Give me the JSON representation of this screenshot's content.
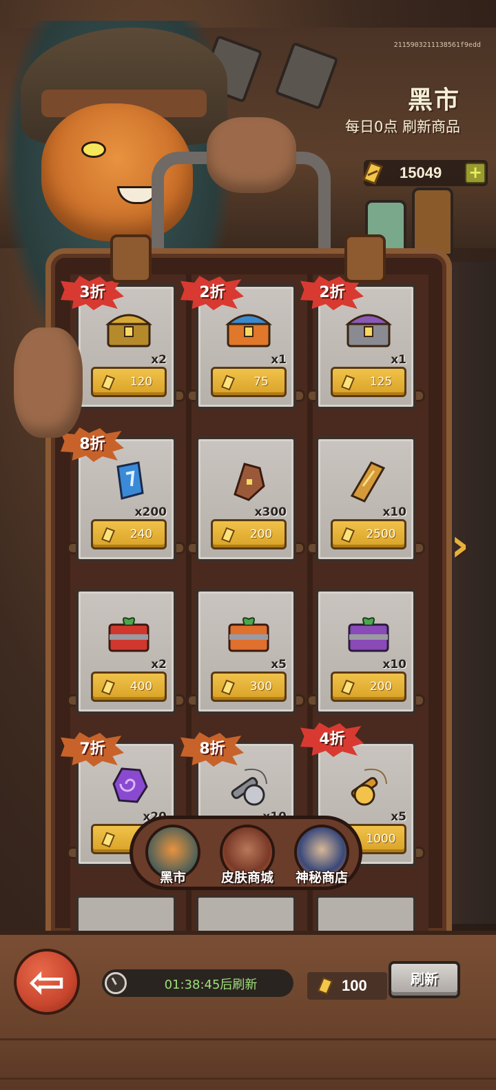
{
  "header": {
    "title": "黑市",
    "subtitle": "每日0点 刷新商品",
    "user_id": "2115903211138561f9edd",
    "currency_amount": "15049",
    "add_currency_label": "+"
  },
  "items": [
    {
      "name": "gold-chest",
      "discount": "3折",
      "discount_color": "red",
      "qty": "x2",
      "price": "120"
    },
    {
      "name": "blue-chest",
      "discount": "2折",
      "discount_color": "red",
      "qty": "x1",
      "price": "75"
    },
    {
      "name": "purple-chest",
      "discount": "2折",
      "discount_color": "red",
      "qty": "x1",
      "price": "125"
    },
    {
      "name": "blue-rune-stone",
      "discount": "8折",
      "discount_color": "orange",
      "qty": "x200",
      "price": "240"
    },
    {
      "name": "brown-coffin-stone",
      "discount": "",
      "discount_color": "",
      "qty": "x300",
      "price": "200"
    },
    {
      "name": "golden-coffin",
      "discount": "",
      "discount_color": "",
      "qty": "x10",
      "price": "2500"
    },
    {
      "name": "red-gift-box",
      "discount": "",
      "discount_color": "",
      "qty": "x2",
      "price": "400"
    },
    {
      "name": "orange-gift-box",
      "discount": "",
      "discount_color": "",
      "qty": "x5",
      "price": "300"
    },
    {
      "name": "purple-gift-box",
      "discount": "",
      "discount_color": "",
      "qty": "x10",
      "price": "200"
    },
    {
      "name": "purple-spiral-stone",
      "discount": "7折",
      "discount_color": "orange",
      "qty": "x20",
      "price": ""
    },
    {
      "name": "silver-fishing-reel",
      "discount": "8折",
      "discount_color": "orange",
      "qty": "x10",
      "price": ""
    },
    {
      "name": "gold-fishing-reel",
      "discount": "4折",
      "discount_color": "red",
      "qty": "x5",
      "price": "1000"
    }
  ],
  "tabs": [
    {
      "label": "黑市",
      "active": true
    },
    {
      "label": "皮肤商城",
      "active": false
    },
    {
      "label": "神秘商店",
      "active": false
    }
  ],
  "bottom": {
    "timer_text": "01:38:45后刷新",
    "refresh_cost": "100",
    "refresh_label": "刷新"
  },
  "colors": {
    "discount_red": "#d83a32",
    "discount_orange": "#c7632a",
    "price_gold": "#f0c24a",
    "timer_green": "#9fe07a"
  }
}
